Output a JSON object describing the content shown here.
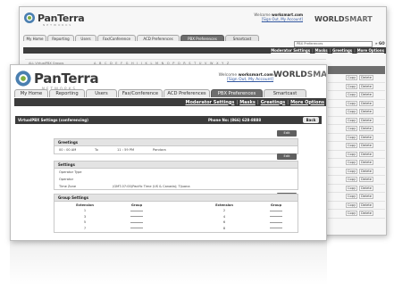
{
  "back_window": {
    "logo": {
      "name": "PanTerra",
      "sub": "NETWORKS"
    },
    "welcome": {
      "text": "Welcome",
      "user": "worksmart.com",
      "links": "[Sign Out, My Account]"
    },
    "brand": {
      "a": "WORLD",
      "b": "SMART"
    },
    "tabs": [
      "My Home",
      "Reporting",
      "Users",
      "Fax/Conference",
      "ACD Preferences",
      "PBX Preferences",
      "Smartcast"
    ],
    "active_tab": 5,
    "search": {
      "value": "PBX Preferences",
      "go": "» GO"
    },
    "subnav": [
      "Moderator Settings",
      "Masks",
      "Greetings",
      "More Options"
    ],
    "alpha": {
      "label": "ALL VirtualPBX Groups",
      "letters": [
        "A",
        "B",
        "C",
        "D",
        "E",
        "F",
        "G",
        "H",
        "I",
        "J",
        "K",
        "L",
        "M",
        "N",
        "O",
        "P",
        "Q",
        "R",
        "S",
        "T",
        "U",
        "V",
        "W",
        "X",
        "Y",
        "Z"
      ]
    },
    "right_col": {
      "rows": [
        [
          "Copy",
          "Delete"
        ],
        [
          "Copy",
          "Delete"
        ],
        [
          "Copy",
          "Delete"
        ],
        [
          "Copy",
          "Delete"
        ],
        [
          "Copy",
          "Delete"
        ],
        [
          "Copy",
          "Delete"
        ],
        [
          "Copy",
          "Delete"
        ],
        [
          "Copy",
          "Delete"
        ],
        [
          "Copy",
          "Delete"
        ],
        [
          "Copy",
          "Delete"
        ],
        [
          "Copy",
          "Delete"
        ],
        [
          "Copy",
          "Delete"
        ],
        [
          "Copy",
          "Delete"
        ],
        [
          "Copy",
          "Delete"
        ],
        [
          "Copy",
          "Delete"
        ],
        [
          "Copy",
          "Delete"
        ],
        [
          "Copy",
          "Delete"
        ]
      ]
    }
  },
  "front_window": {
    "logo": {
      "name": "PanTerra",
      "sub": "NETWORKS"
    },
    "welcome": {
      "text": "Welcome",
      "user": "worksmart.com",
      "links": "[Sign Out, My Account]"
    },
    "brand": {
      "a": "WORLD",
      "b": "SMART"
    },
    "tabs": [
      "My Home",
      "Reporting",
      "Users",
      "Fax/Conference",
      "ACD Preferences",
      "PBX Preferences",
      "Smartcast"
    ],
    "active_tab": 5,
    "subnav": [
      "Moderator Settings",
      "Masks",
      "Greetings",
      "More Options"
    ],
    "page_title": "VirtualPBX Settings  (conferencing)",
    "phone": "Phone No: (866) 628-8888",
    "back_label": "Back",
    "edit_label": "Edit",
    "greetings": {
      "title": "Greetings",
      "row": [
        "00 : 00 AM",
        "To",
        "11 : 59  PM",
        "Pandora"
      ]
    },
    "settings": {
      "title": "Settings",
      "rows": [
        {
          "label": "Operator Type",
          "value": ""
        },
        {
          "label": "Operator",
          "value": ""
        },
        {
          "label": "Time Zone",
          "value": "(GMT-07:00)Pacific Time (US & Canada); Tijuana"
        }
      ]
    },
    "group_settings": {
      "title": "Group Settings",
      "headers": [
        "Extension",
        "Group",
        "Extension",
        "Group"
      ],
      "rows": [
        [
          "1",
          "2"
        ],
        [
          "3",
          "4"
        ],
        [
          "5",
          "6"
        ],
        [
          "7",
          "8"
        ],
        [
          "",
          ""
        ]
      ],
      "rows_ext": [
        [
          "1",
          "2"
        ],
        [
          "3",
          "4"
        ],
        [
          "5",
          "6"
        ],
        [
          "7",
          "8"
        ]
      ]
    }
  }
}
